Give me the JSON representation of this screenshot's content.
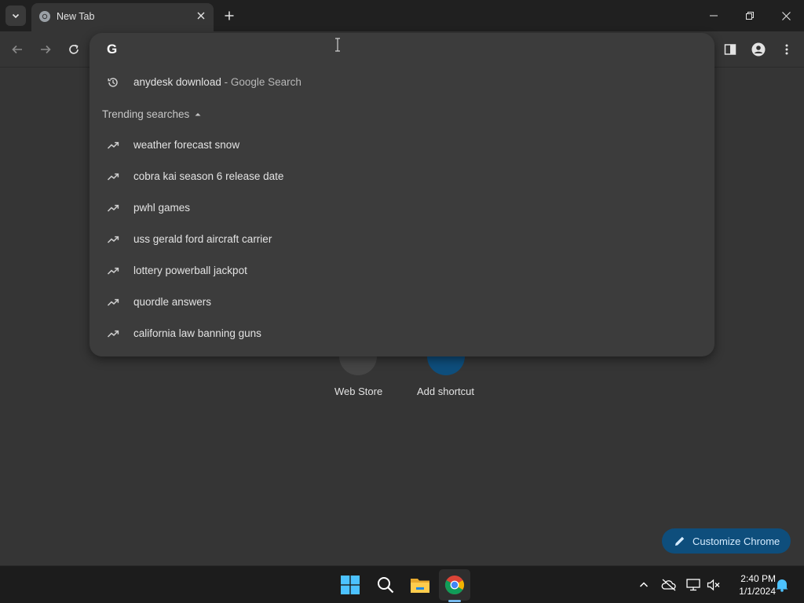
{
  "browser": {
    "tab": {
      "title": "New Tab"
    },
    "colors": {
      "accent": "#0e4e7c",
      "link_blue": "#1a73e8"
    }
  },
  "omnibox": {
    "value": "",
    "history_item": {
      "query": "anydesk download",
      "suffix": "- Google Search",
      "icon": "history-icon"
    },
    "trending_header": "Trending searches",
    "trending": [
      "weather forecast snow",
      "cobra kai season 6 release date",
      "pwhl games",
      "uss gerald ford aircraft carrier",
      "lottery powerball jackpot",
      "quordle answers",
      "california law banning guns"
    ]
  },
  "ntp": {
    "shortcuts": [
      {
        "label": "Web Store"
      },
      {
        "label": "Add shortcut"
      }
    ],
    "customize_label": "Customize Chrome"
  },
  "taskbar": {
    "time": "2:40 PM",
    "date": "1/1/2024"
  }
}
